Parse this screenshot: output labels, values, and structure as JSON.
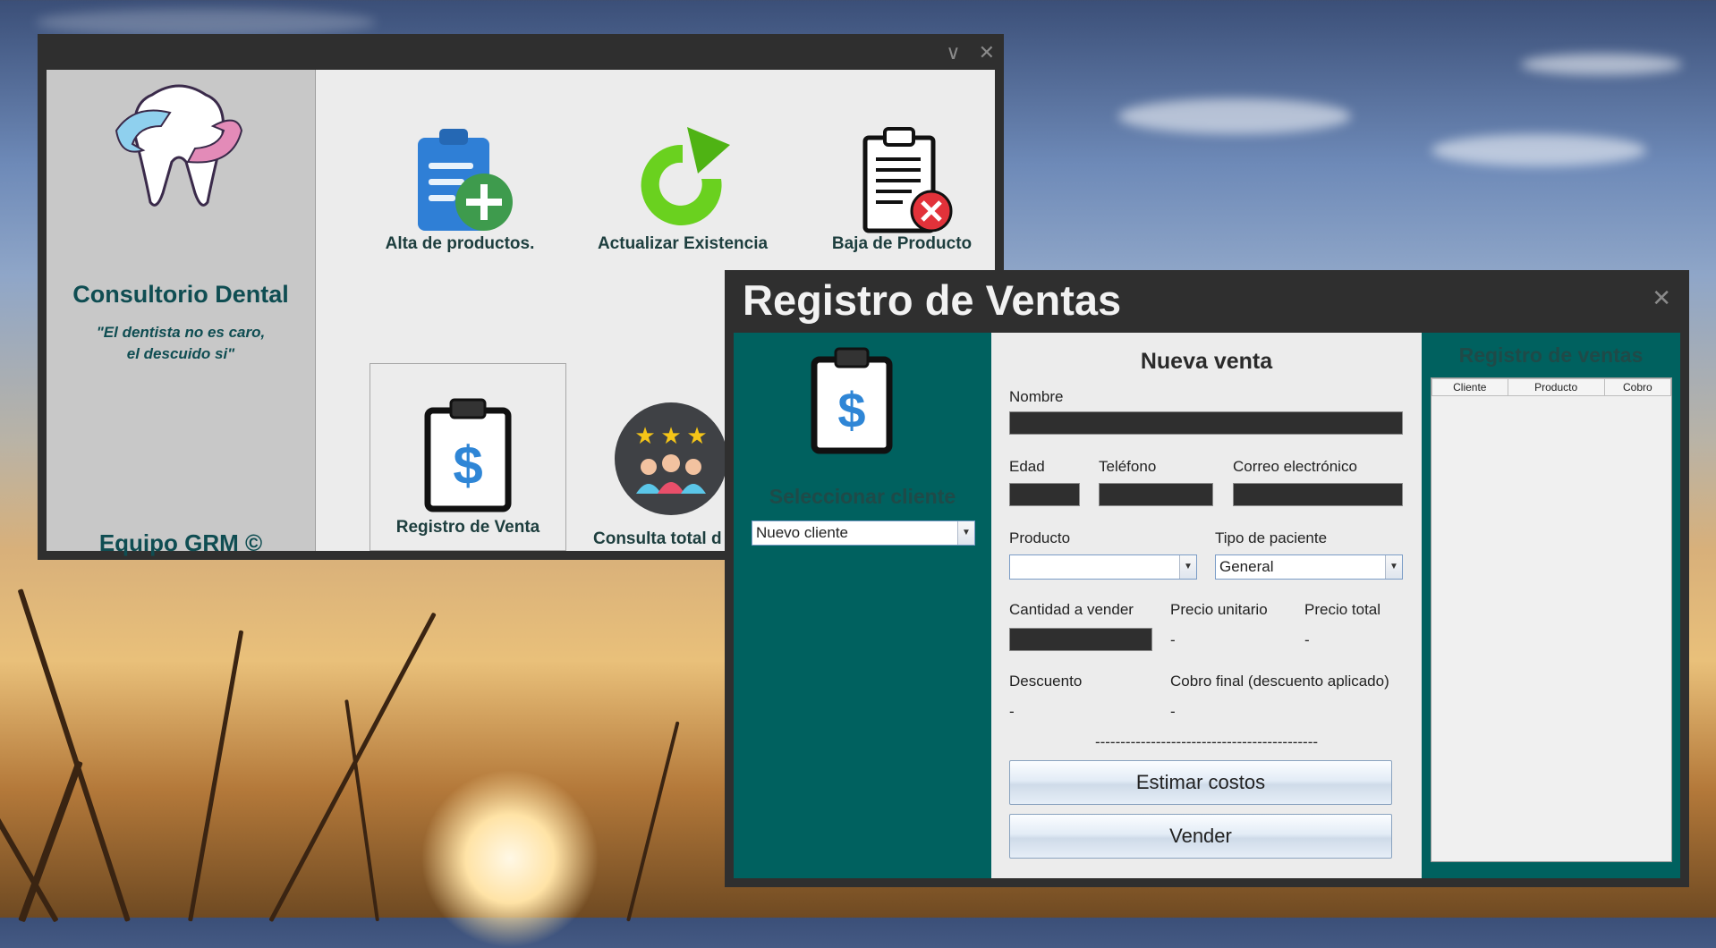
{
  "main_window": {
    "brand": {
      "title": "Consultorio Dental",
      "quote_line1": "\"El dentista no es caro,",
      "quote_line2": "el descuido si\"",
      "team": "Equipo GRM ©"
    },
    "tiles": [
      {
        "label": "Alta de productos."
      },
      {
        "label": "Actualizar Existencia"
      },
      {
        "label": "Baja de Producto"
      },
      {
        "label": "Registro de Venta"
      },
      {
        "label": "Consulta total d"
      }
    ]
  },
  "sales_window": {
    "title": "Registro de Ventas",
    "left_panel": {
      "select_client_label": "Seleccionar cliente",
      "client_select_value": "Nuevo cliente"
    },
    "form": {
      "heading": "Nueva venta",
      "nombre_label": "Nombre",
      "edad_label": "Edad",
      "telefono_label": "Teléfono",
      "correo_label": "Correo electrónico",
      "producto_label": "Producto",
      "producto_value": "",
      "tipo_paciente_label": "Tipo de paciente",
      "tipo_paciente_value": "General",
      "cantidad_label": "Cantidad a vender",
      "precio_unitario_label": "Precio unitario",
      "precio_unitario_value": "-",
      "precio_total_label": "Precio total",
      "precio_total_value": "-",
      "descuento_label": "Descuento",
      "descuento_value": "-",
      "cobro_final_label": "Cobro final (descuento aplicado)",
      "cobro_final_value": "-",
      "separator": "--------------------------------------------",
      "estimar_button": "Estimar costos",
      "vender_button": "Vender"
    },
    "right_panel": {
      "heading": "Registro de ventas",
      "columns": [
        "Cliente",
        "Producto",
        "Cobro"
      ]
    }
  },
  "colors": {
    "teal_panel": "#00615f",
    "dark_title": "#0f4d52",
    "window_chrome": "#2f2f2f"
  }
}
